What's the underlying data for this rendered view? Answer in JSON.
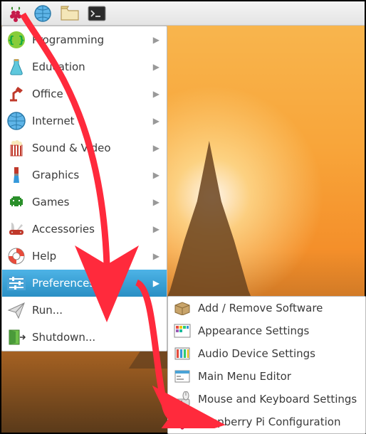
{
  "taskbar": {
    "items": [
      {
        "name": "start-menu",
        "icon": "raspberry"
      },
      {
        "name": "web-browser",
        "icon": "globe"
      },
      {
        "name": "file-manager",
        "icon": "folder"
      },
      {
        "name": "terminal",
        "icon": "terminal"
      }
    ]
  },
  "menu": {
    "items": [
      {
        "label": "Programming",
        "icon": "braces",
        "submenu": true
      },
      {
        "label": "Education",
        "icon": "flask",
        "submenu": true
      },
      {
        "label": "Office",
        "icon": "lamp",
        "submenu": true
      },
      {
        "label": "Internet",
        "icon": "globe-big",
        "submenu": true
      },
      {
        "label": "Sound & Video",
        "icon": "popcorn",
        "submenu": true
      },
      {
        "label": "Graphics",
        "icon": "brush",
        "submenu": true
      },
      {
        "label": "Games",
        "icon": "invader",
        "submenu": true
      },
      {
        "label": "Accessories",
        "icon": "knife",
        "submenu": true
      },
      {
        "label": "Help",
        "icon": "lifebuoy",
        "submenu": true
      },
      {
        "label": "Preferences",
        "icon": "sliders",
        "submenu": true,
        "selected": true
      },
      {
        "label": "Run...",
        "icon": "paperplane",
        "submenu": false
      },
      {
        "label": "Shutdown...",
        "icon": "exit",
        "submenu": false
      }
    ]
  },
  "submenu": {
    "items": [
      {
        "label": "Add / Remove Software",
        "icon": "package"
      },
      {
        "label": "Appearance Settings",
        "icon": "palette"
      },
      {
        "label": "Audio Device Settings",
        "icon": "audio"
      },
      {
        "label": "Main Menu Editor",
        "icon": "editor"
      },
      {
        "label": "Mouse and Keyboard Settings",
        "icon": "mouse"
      },
      {
        "label": "Raspberry Pi Configuration",
        "icon": "raspberry-sm"
      }
    ]
  },
  "annotation": {
    "arrow_color": "#ff2a3c",
    "description": "arrow from start menu to Preferences to Raspberry Pi Configuration"
  }
}
